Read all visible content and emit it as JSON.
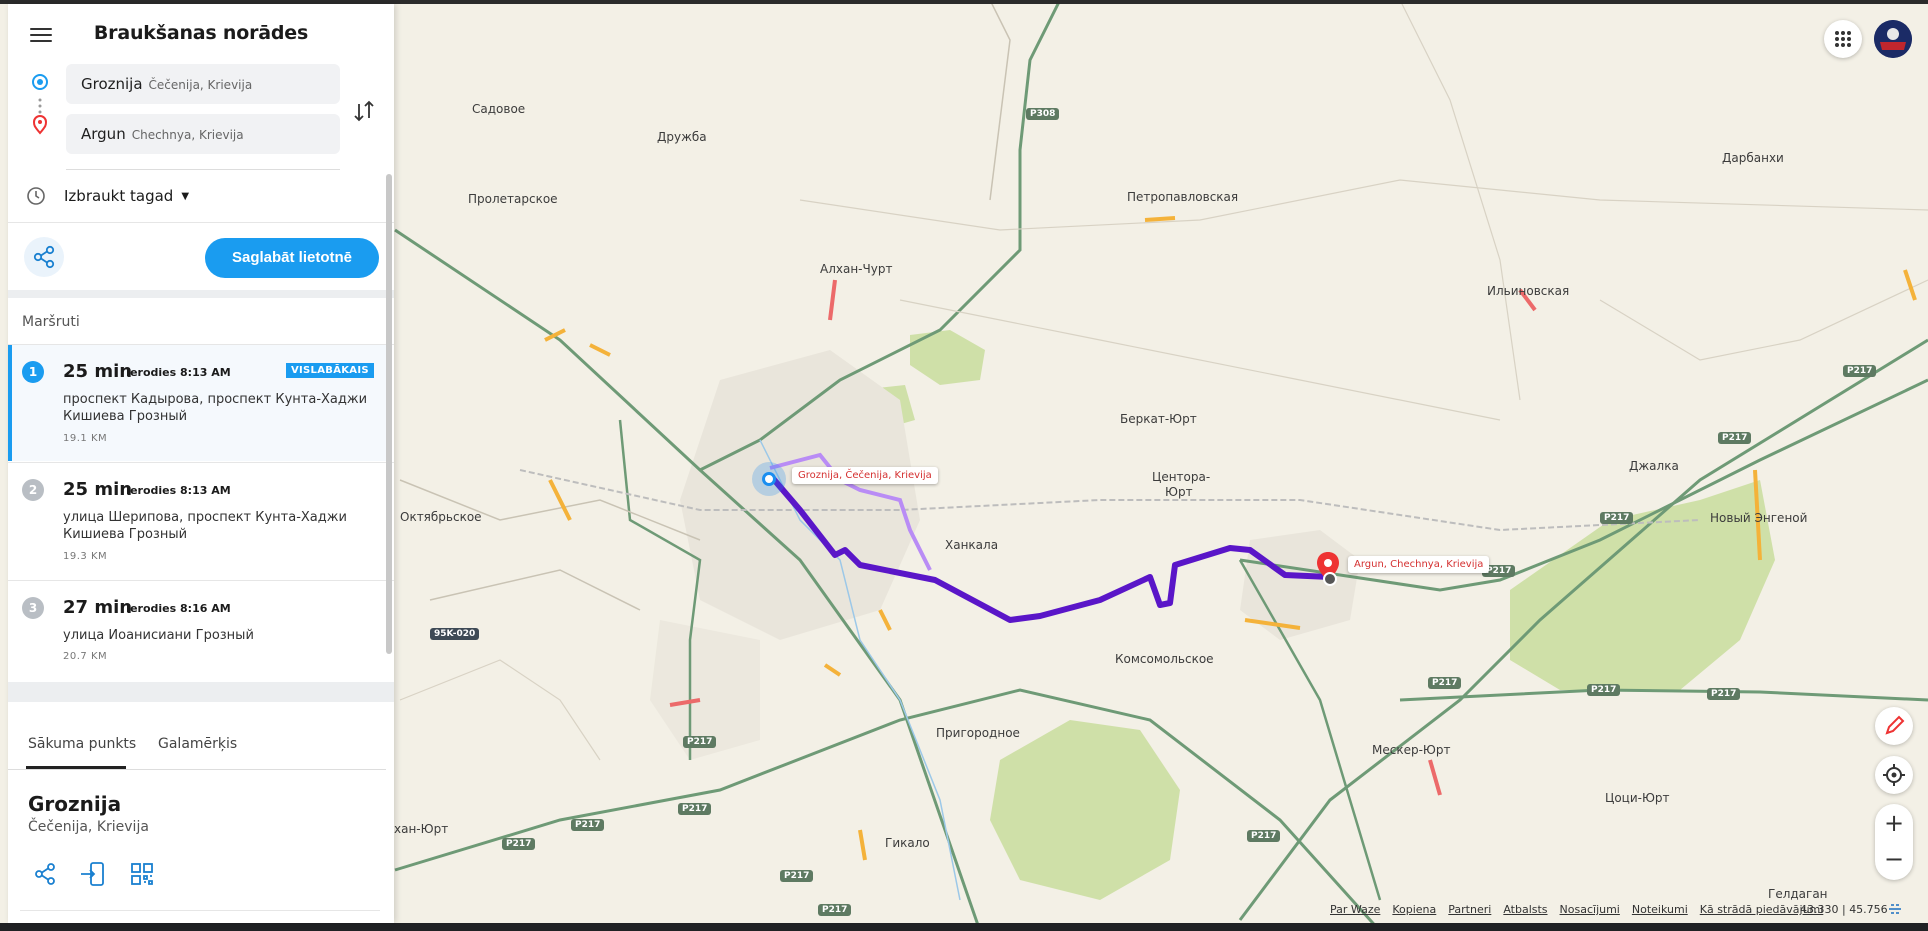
{
  "panel": {
    "title": "Braukšanas norādes",
    "origin": {
      "name": "Groznija",
      "sub": "Čečenija, Krievija"
    },
    "destination": {
      "name": "Argun",
      "sub": "Chechnya, Krievija"
    },
    "depart_label": "Izbraukt tagad",
    "save_label": "Saglabāt lietotnē",
    "routes_header": "Maršruti",
    "routes": [
      {
        "num": "1",
        "time": "25 min",
        "arrival": "Ierodies 8:13 AM",
        "badge": "VISLABĀKAIS",
        "desc": "проспект Кадырова, проспект Кунта-Хаджи Кишиева Грозный",
        "distance": "19.1 KM"
      },
      {
        "num": "2",
        "time": "25 min",
        "arrival": "Ierodies 8:13 AM",
        "desc": "улица Шерипова, проспект Кунта-Хаджи Кишиева Грозный",
        "distance": "19.3 KM"
      },
      {
        "num": "3",
        "time": "27 min",
        "arrival": "Ierodies 8:16 AM",
        "desc": "улица Иоанисиани Грозный",
        "distance": "20.7 KM"
      }
    ],
    "tabs": {
      "start": "Sākuma punkts",
      "destination": "Galamērķis"
    },
    "place": {
      "name": "Groznija",
      "sub": "Čečenija, Krievija"
    }
  },
  "map": {
    "towns": {
      "sadovoe": "Садовое",
      "druzhba": "Дружба",
      "proletarskoe": "Пролетарское",
      "alkhan_churt": "Алхан-Чурт",
      "petropavlovskaya": "Петропавловская",
      "darbankhi": "Дарбанхи",
      "ilinovskaya": "Ильиновская",
      "berkat_yurt": "Беркат-Юрт",
      "tsentora_yurt_1": "Центора-",
      "tsentora_yurt_2": "Юрт",
      "dzhalka": "Джалка",
      "oktyabrskoe": "Октябрьское",
      "khankala": "Ханкала",
      "novy_engenoy": "Новый Энгеной",
      "komsomolskoe": "Комсомольское",
      "prigorodnoe": "Пригородное",
      "mesker_yurt": "Мескер-Юрт",
      "tsotsi_yurt": "Цоци-Юрт",
      "kan_yurt": "хан-Юрт",
      "gikalo": "Гикало",
      "geldagan": "Гелдаган"
    },
    "shields": {
      "p308": "P308",
      "p217": "P217",
      "k95": "95K-020"
    },
    "origin_tag": "Groznija, Čečenija, Krievija",
    "destination_tag": "Argun, Chechnya, Krievija",
    "footer": [
      "Par Waze",
      "Kopiena",
      "Partneri",
      "Atbalsts",
      "Nosacījumi",
      "Noteikumi",
      "Kā strādā piedāvājumi"
    ],
    "coords": "43.330 | 45.756",
    "route_color": "#5a16c8",
    "alt_route_color": "#b98cf5"
  }
}
